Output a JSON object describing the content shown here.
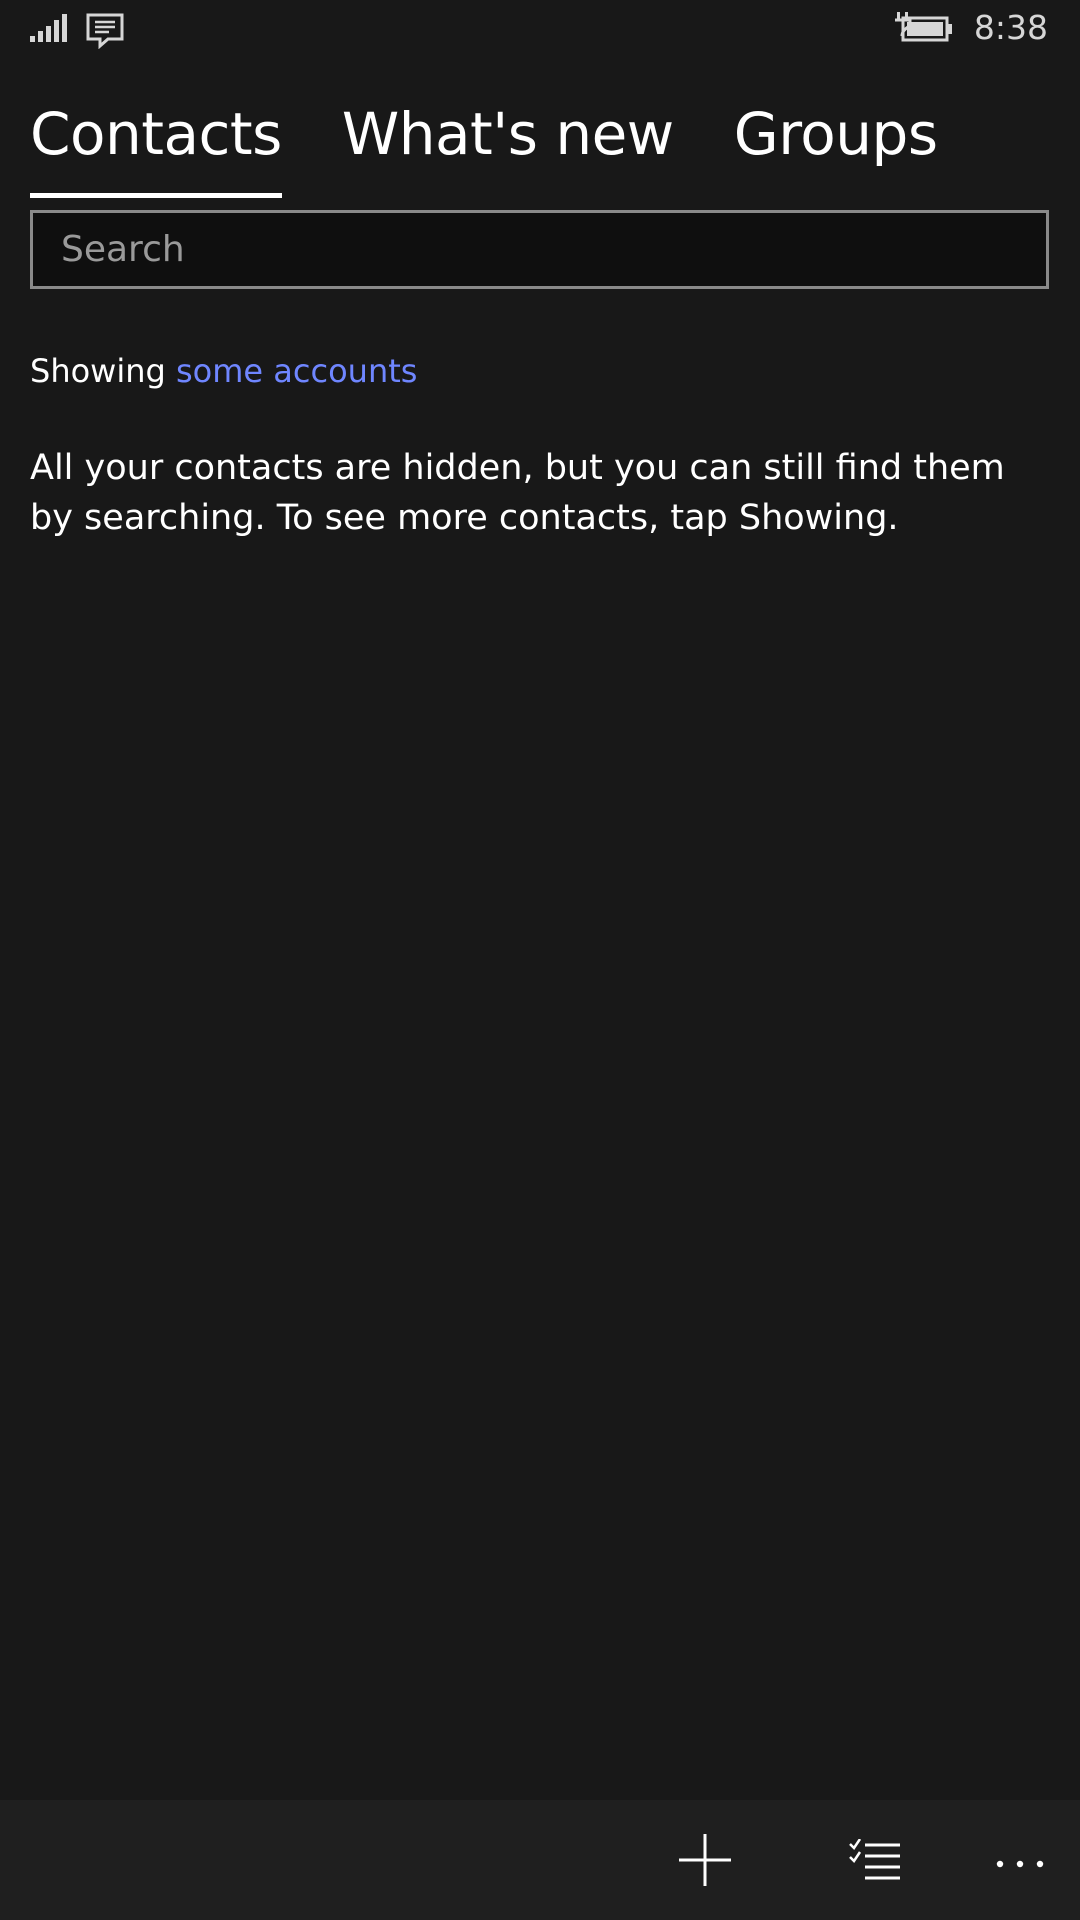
{
  "status_bar": {
    "time": "8:38",
    "icons": [
      "signal-icon",
      "message-icon",
      "battery-charging-icon"
    ]
  },
  "pivot": {
    "tabs": [
      {
        "label": "Contacts",
        "selected": true
      },
      {
        "label": "What's new",
        "selected": false
      },
      {
        "label": "Groups",
        "selected": false
      }
    ]
  },
  "search": {
    "placeholder": "Search",
    "value": ""
  },
  "filter": {
    "prefix": "Showing",
    "link": "some accounts"
  },
  "message": "All your contacts are hidden, but you can still find them by searching. To see more contacts, tap Showing.",
  "app_bar": {
    "buttons": [
      "add-icon",
      "select-list-icon",
      "more-icon"
    ]
  },
  "colors": {
    "background": "#181818",
    "app_bar": "#1f1f1f",
    "link": "#6f86ff",
    "search_border": "#8a8a8a"
  }
}
